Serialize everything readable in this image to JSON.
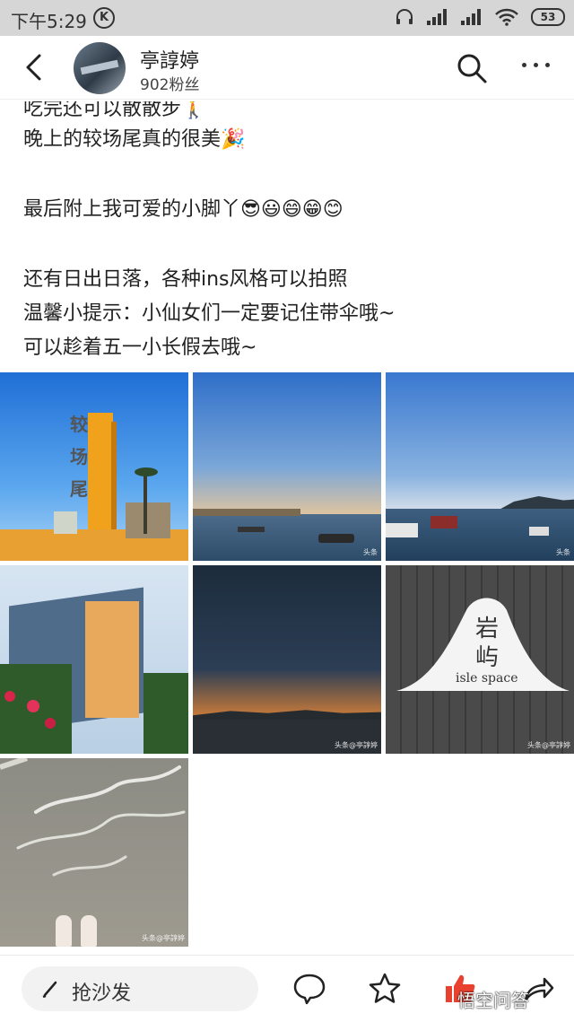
{
  "status_bar": {
    "time": "下午5:29",
    "k_badge": "K",
    "battery": "53"
  },
  "header": {
    "username": "亭諄婷",
    "fans": "902粉丝"
  },
  "post": {
    "lines": [
      "吃完还可以散散步🚶",
      "晚上的较场尾真的很美🎉",
      "",
      "最后附上我可爱的小脚丫😎😃😄😁😊",
      "",
      "还有日出日落，各种ins风格可以拍照",
      "温馨小提示：小仙女们一定要记住带伞哦~",
      "可以趁着五一小长假去哦~"
    ]
  },
  "photos": {
    "photo1_sign": "较场尾",
    "photo2_wm": "头条",
    "photo3_wm": "头条",
    "photo5_wm": "头条@亭諄婷",
    "photo6_sign_line1": "岩",
    "photo6_sign_line2": "屿",
    "photo6_sign_line3": "isle space",
    "photo6_wm": "头条@亭諄婷",
    "photo7_wm": "头条@亭諄婷"
  },
  "bottom_bar": {
    "comment_placeholder": "抢沙发",
    "watermark": "悟空问答"
  },
  "colors": {
    "status_bg": "#d6d6d6",
    "like_red": "#e8412f"
  }
}
